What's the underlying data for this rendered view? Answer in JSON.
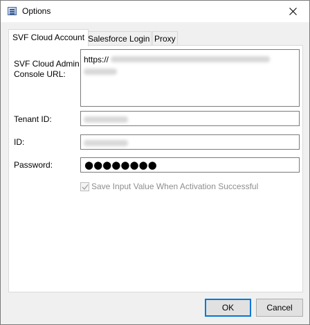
{
  "window": {
    "title": "Options",
    "icons": {
      "app": "options-window-icon",
      "close": "close-icon"
    }
  },
  "tabs": [
    {
      "label": "SVF Cloud Account",
      "active": true
    },
    {
      "label": "Salesforce Login",
      "active": false
    },
    {
      "label": "Proxy",
      "active": false
    }
  ],
  "form": {
    "url_label": "SVF Cloud Admin Console URL:",
    "url_value_prefix": "https://",
    "tenant_label": "Tenant ID:",
    "id_label": "ID:",
    "password_label": "Password:",
    "password_mask": "●●●●●●●●",
    "save_checkbox_label": "Save Input Value When Activation Successful",
    "save_checkbox_checked": true,
    "save_checkbox_enabled": false
  },
  "buttons": {
    "ok": "OK",
    "cancel": "Cancel"
  },
  "colors": {
    "accent": "#0078d7",
    "disabled_text": "#8d8d8d"
  }
}
